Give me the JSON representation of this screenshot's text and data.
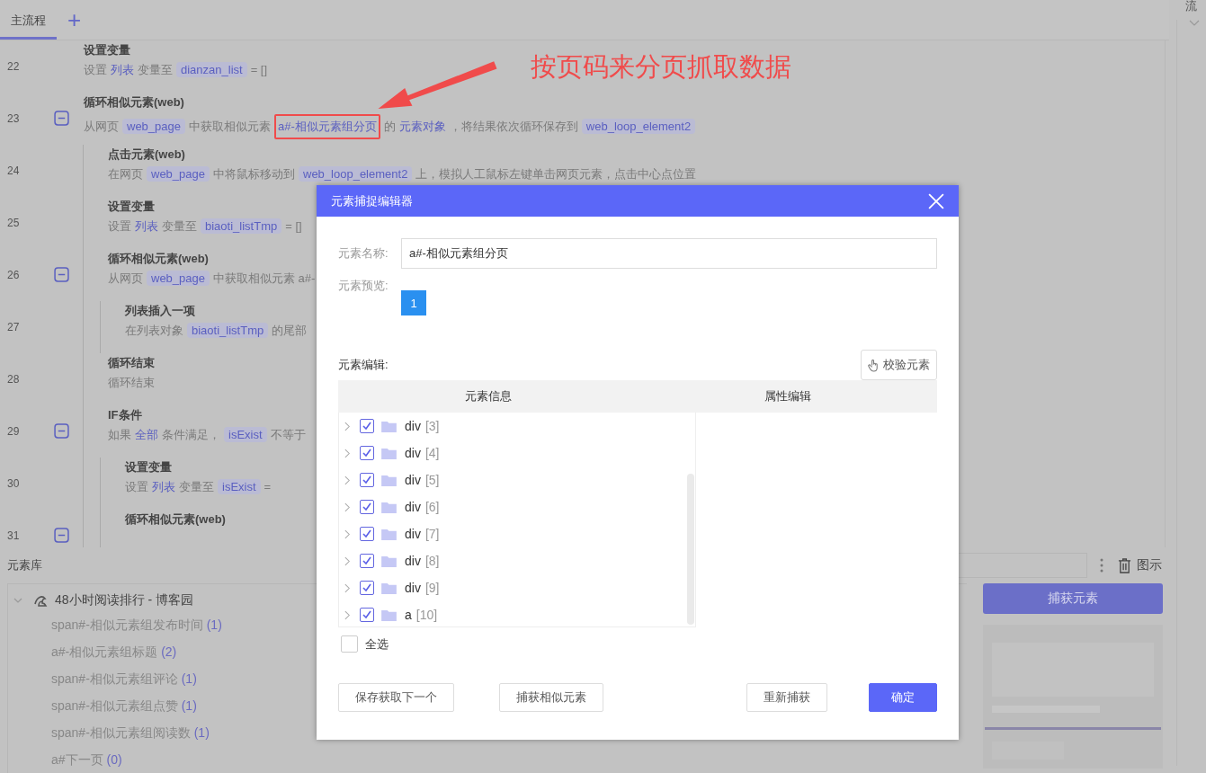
{
  "tabs": [
    {
      "label": "主流程",
      "selected": true
    }
  ],
  "add_tab": "+",
  "side_label": "流",
  "steps": [
    {
      "line": "22",
      "title": "设置变量",
      "desc": [
        {
          "kind": "text",
          "text": "设置"
        },
        {
          "kind": "keyword",
          "text": "列表"
        },
        {
          "kind": "text",
          "text": "变量至"
        },
        {
          "kind": "var",
          "text": "dianzan_list"
        },
        {
          "kind": "text",
          "text": "= []"
        }
      ]
    },
    {
      "line": "23",
      "title": "循环相似元素(web)",
      "expanded": true,
      "desc": [
        {
          "kind": "text",
          "text": "从网页"
        },
        {
          "kind": "var",
          "text": "web_page"
        },
        {
          "kind": "text",
          "text": "中获取相似元素"
        },
        {
          "kind": "keyword",
          "text": "a#-相似元素组分页",
          "boxed": true
        },
        {
          "kind": "text",
          "text": "的"
        },
        {
          "kind": "keyword",
          "text": "元素对象"
        },
        {
          "kind": "text",
          "text": "，将结果依次循环保存到"
        },
        {
          "kind": "var",
          "text": "web_loop_element2"
        }
      ],
      "children": [
        {
          "line": "24",
          "title": "点击元素(web)",
          "desc": [
            {
              "kind": "text",
              "text": "在网页"
            },
            {
              "kind": "var",
              "text": "web_page"
            },
            {
              "kind": "text",
              "text": "中将鼠标移动到"
            },
            {
              "kind": "var",
              "text": "web_loop_element2"
            },
            {
              "kind": "text",
              "text": "上，模拟人工鼠标左键单击网页元素，点击中心点位置"
            }
          ]
        },
        {
          "line": "25",
          "title": "设置变量",
          "desc": [
            {
              "kind": "text",
              "text": "设置"
            },
            {
              "kind": "keyword",
              "text": "列表"
            },
            {
              "kind": "text",
              "text": "变量至"
            },
            {
              "kind": "var",
              "text": "biaoti_listTmp"
            },
            {
              "kind": "text",
              "text": "= []"
            }
          ]
        },
        {
          "line": "26",
          "title": "循环相似元素(web)",
          "expanded": true,
          "desc": [
            {
              "kind": "text",
              "text": "从网页"
            },
            {
              "kind": "var",
              "text": "web_page"
            },
            {
              "kind": "text",
              "text": "中获取相似元素 a#-"
            }
          ],
          "children": [
            {
              "line": "27",
              "title": "列表插入一项",
              "desc": [
                {
                  "kind": "text",
                  "text": "在列表对象"
                },
                {
                  "kind": "var",
                  "text": "biaoti_listTmp"
                },
                {
                  "kind": "text",
                  "text": "的尾部"
                }
              ]
            }
          ]
        },
        {
          "line": "28",
          "title": "循环结束",
          "desc": [
            {
              "kind": "text",
              "text": "循环结束"
            }
          ]
        },
        {
          "line": "29",
          "title": "IF条件",
          "expanded": true,
          "desc": [
            {
              "kind": "text",
              "text": "如果"
            },
            {
              "kind": "keyword",
              "text": "全部"
            },
            {
              "kind": "text",
              "text": "条件满足，"
            },
            {
              "kind": "var",
              "text": "isExist"
            },
            {
              "kind": "text",
              "text": "不等于"
            }
          ],
          "children": [
            {
              "line": "30",
              "title": "设置变量",
              "desc": [
                {
                  "kind": "text",
                  "text": "设置"
                },
                {
                  "kind": "keyword",
                  "text": "列表"
                },
                {
                  "kind": "text",
                  "text": "变量至"
                },
                {
                  "kind": "var",
                  "text": "isExist"
                },
                {
                  "kind": "text",
                  "text": "="
                }
              ]
            },
            {
              "line": "31",
              "title": "循环相似元素(web)",
              "expanded": true
            }
          ]
        }
      ]
    }
  ],
  "annotation": {
    "text": "按页码来分页抓取数据"
  },
  "library": {
    "title": "元素库",
    "legend": "图示",
    "capture_button": "捕获元素",
    "root": {
      "label": "48小时阅读排行 - 博客园",
      "expanded": true,
      "children": [
        {
          "name": "span#-相似元素组发布时间",
          "count": "(1)"
        },
        {
          "name": "a#-相似元素组标题",
          "count": "(2)"
        },
        {
          "name": "span#-相似元素组评论",
          "count": "(1)"
        },
        {
          "name": "span#-相似元素组点赞",
          "count": "(1)"
        },
        {
          "name": "span#-相似元素组阅读数",
          "count": "(1)"
        },
        {
          "name": "a#下一页",
          "count": "(0)"
        }
      ]
    }
  },
  "dialog": {
    "title": "元素捕捉编辑器",
    "name_label": "元素名称:",
    "name_value": "a#-相似元素组分页",
    "preview_label": "元素预览:",
    "preview_value": "1",
    "edit_label": "元素编辑:",
    "verify_button": "校验元素",
    "columns": [
      "元素信息",
      "属性编辑"
    ],
    "nodes": [
      {
        "tag": "div",
        "index": "[3]",
        "checked": true
      },
      {
        "tag": "div",
        "index": "[4]",
        "checked": true
      },
      {
        "tag": "div",
        "index": "[5]",
        "checked": true
      },
      {
        "tag": "div",
        "index": "[6]",
        "checked": true
      },
      {
        "tag": "div",
        "index": "[7]",
        "checked": true
      },
      {
        "tag": "div",
        "index": "[8]",
        "checked": true
      },
      {
        "tag": "div",
        "index": "[9]",
        "checked": true
      },
      {
        "tag": "a",
        "index": "[10]",
        "checked": true
      }
    ],
    "select_all": {
      "label": "全选",
      "checked": false
    },
    "buttons": [
      {
        "label": "保存获取下一个",
        "kind": "plain"
      },
      {
        "label": "捕获相似元素",
        "kind": "plain"
      },
      {
        "label": "重新捕获",
        "kind": "plain"
      },
      {
        "label": "确定",
        "kind": "primary"
      }
    ]
  }
}
